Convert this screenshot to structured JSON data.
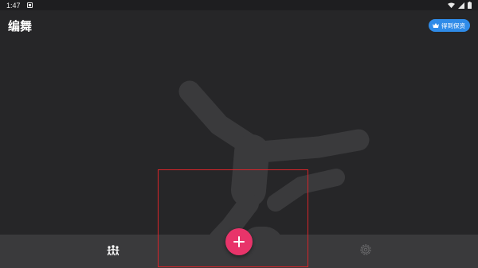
{
  "status_bar": {
    "time": "1:47",
    "notification_icon": "app-notification-icon",
    "icons": [
      "wifi-icon",
      "cell-signal-icon",
      "battery-icon"
    ]
  },
  "header": {
    "title": "编舞",
    "vip_button_label": "得到保资",
    "vip_icon": "crown-icon"
  },
  "main": {
    "illustration": "breakdancer-silhouette"
  },
  "bottom_nav": {
    "left_item_icon": "dancers-icon",
    "center_button_icon": "plus-icon",
    "right_item_icon": "settings-gear-icon"
  },
  "colors": {
    "background": "#262628",
    "nav_bar": "#3a3a3c",
    "accent_pink": "#e8346a",
    "vip_blue": "#2f8be8",
    "highlight_red": "#d8242a"
  }
}
